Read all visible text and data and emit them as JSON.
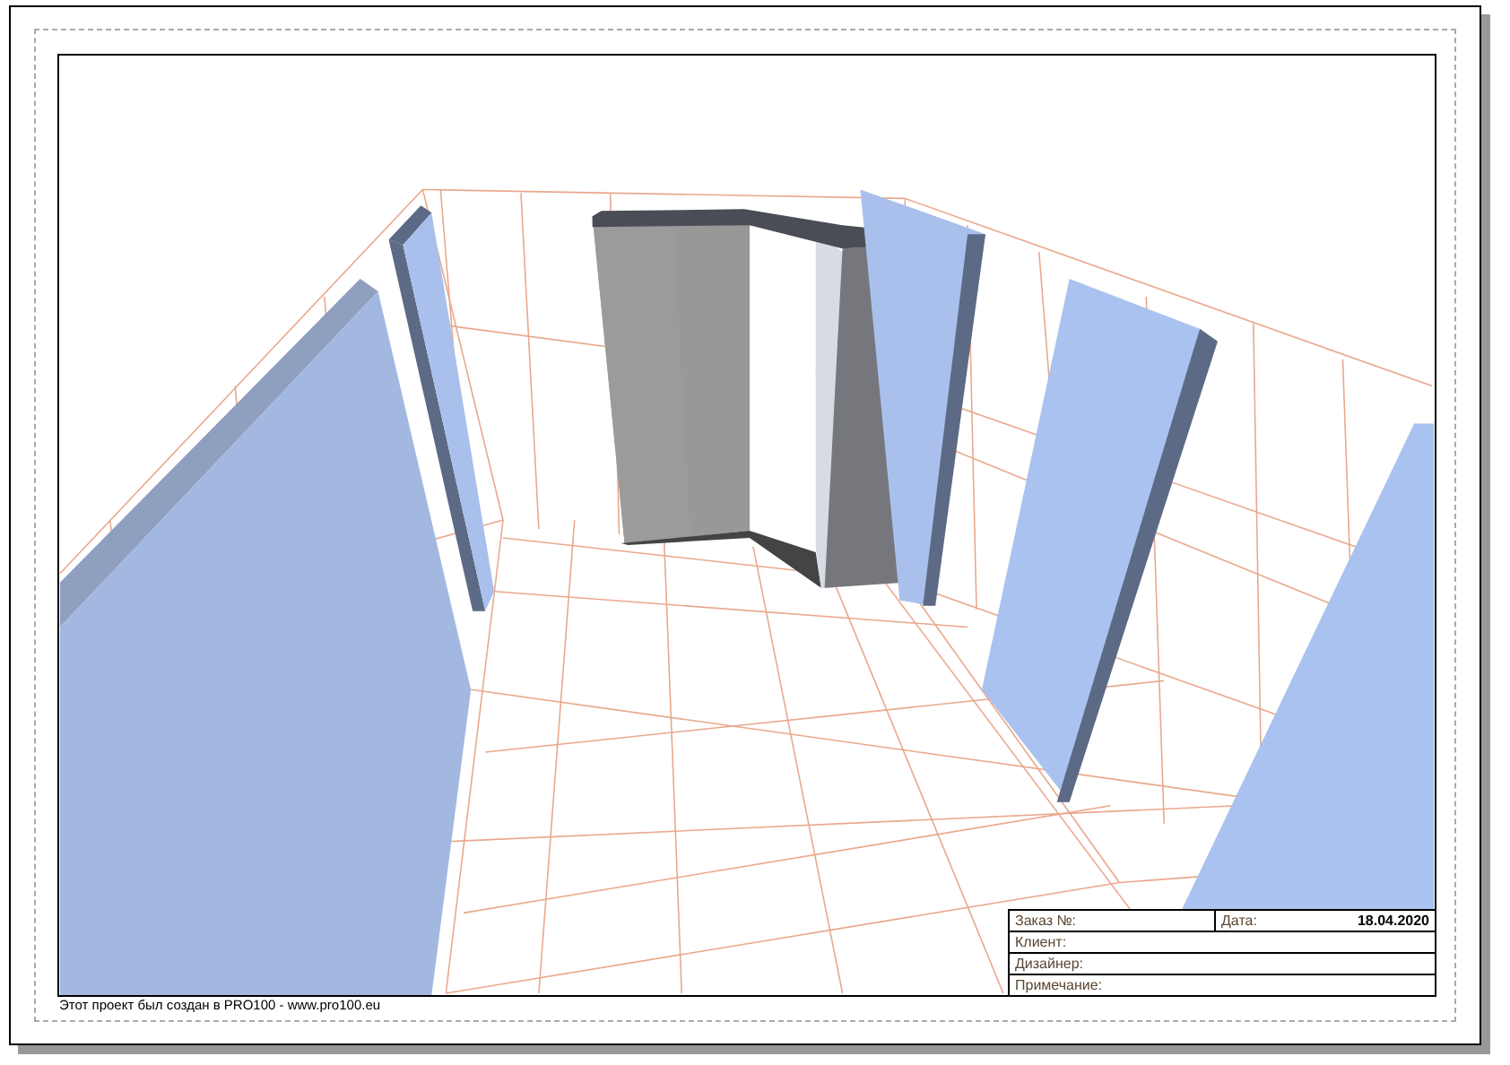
{
  "title_block": {
    "order_label": "Заказ №:",
    "date_label": "Дата:",
    "date": "18.04.2020",
    "rows": [
      "Клиент:",
      "Дизайнер:",
      "Примечание:"
    ]
  },
  "footer": "Этот проект был создан в PRO100 - www.pro100.eu"
}
